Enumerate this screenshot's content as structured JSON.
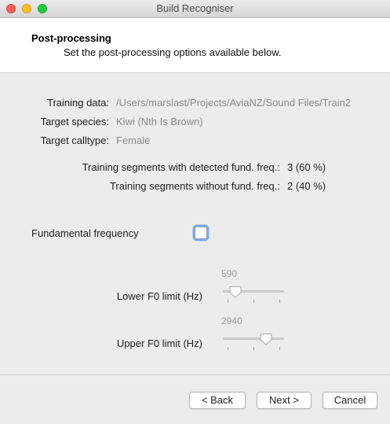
{
  "window": {
    "title": "Build Recogniser"
  },
  "header": {
    "title": "Post-processing",
    "subtitle": "Set the post-processing options available below."
  },
  "info": {
    "training_data_label": "Training data:",
    "training_data_value": "/Users/marslast/Projects/AviaNZ/Sound Files/Train2",
    "target_species_label": "Target species:",
    "target_species_value": "Kiwi (Nth Is Brown)",
    "target_calltype_label": "Target calltype:",
    "target_calltype_value": "Female"
  },
  "stats": {
    "with_f0_label": "Training segments with detected fund. freq.:",
    "with_f0_value": "3 (60 %)",
    "without_f0_label": "Training segments without fund. freq.:",
    "without_f0_value": "2 (40 %)"
  },
  "fundamental": {
    "label": "Fundamental frequency",
    "checked": false
  },
  "sliders": {
    "lower": {
      "label": "Lower F0 limit (Hz)",
      "value": "590",
      "fraction": 0.2
    },
    "upper": {
      "label": "Upper F0 limit (Hz)",
      "value": "2940",
      "fraction": 0.7
    }
  },
  "buttons": {
    "back": "< Back",
    "next": "Next >",
    "cancel": "Cancel"
  }
}
